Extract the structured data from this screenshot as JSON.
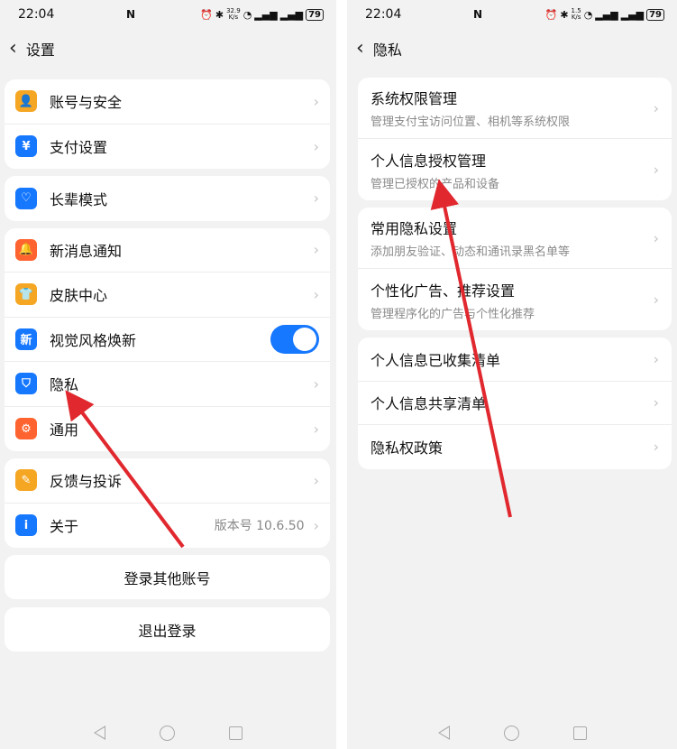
{
  "status": {
    "time": "22:04",
    "nfc": "N",
    "speed_left_top": "32.9",
    "speed_left_bottom": "K/s",
    "speed_right_top": "1.5",
    "speed_right_bottom": "K/s",
    "battery": "79"
  },
  "left": {
    "title": "设置",
    "groups": [
      [
        {
          "label": "账号与安全",
          "icon": "user-icon",
          "color": "#f5a623"
        },
        {
          "label": "支付设置",
          "icon": "yuan-icon",
          "color": "#1677ff"
        }
      ],
      [
        {
          "label": "长辈模式",
          "icon": "heart-icon",
          "color": "#1677ff"
        }
      ],
      [
        {
          "label": "新消息通知",
          "icon": "bell-icon",
          "color": "#ff6430"
        },
        {
          "label": "皮肤中心",
          "icon": "shirt-icon",
          "color": "#f5a623"
        },
        {
          "label": "视觉风格焕新",
          "icon": "new-icon",
          "color": "#1677ff"
        },
        {
          "label": "隐私",
          "icon": "shield-icon",
          "color": "#1677ff"
        },
        {
          "label": "通用",
          "icon": "gear-icon",
          "color": "#ff6430"
        }
      ],
      [
        {
          "label": "反馈与投诉",
          "icon": "pencil-icon",
          "color": "#f5a623"
        },
        {
          "label": "关于",
          "icon": "info-icon",
          "color": "#1677ff",
          "version": "版本号 10.6.50"
        }
      ]
    ],
    "buttons": {
      "switch_account": "登录其他账号",
      "logout": "退出登录"
    }
  },
  "right": {
    "title": "隐私",
    "groups": [
      [
        {
          "title": "系统权限管理",
          "sub": "管理支付宝访问位置、相机等系统权限"
        },
        {
          "title": "个人信息授权管理",
          "sub": "管理已授权的产品和设备"
        }
      ],
      [
        {
          "title": "常用隐私设置",
          "sub": "添加朋友验证、动态和通讯录黑名单等"
        },
        {
          "title": "个性化广告、推荐设置",
          "sub": "管理程序化的广告与个性化推荐"
        }
      ],
      [
        {
          "title": "个人信息已收集清单"
        },
        {
          "title": "个人信息共享清单"
        },
        {
          "title": "隐私权政策"
        }
      ]
    ]
  },
  "colors": {
    "accent": "#1677ff",
    "arrow": "#e0282e"
  }
}
